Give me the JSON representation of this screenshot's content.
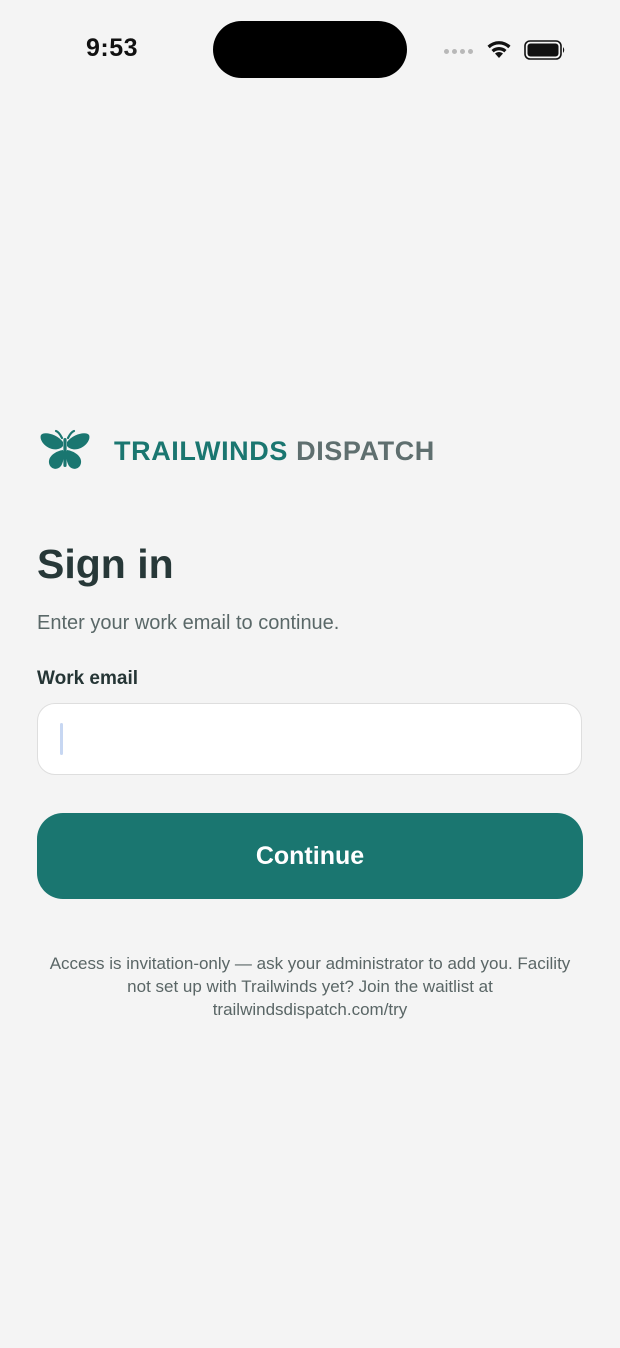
{
  "status_bar": {
    "time": "9:53"
  },
  "brand": {
    "logo_icon": "butterfly-icon",
    "name_primary": "TRAILWINDS",
    "name_secondary": "DISPATCH",
    "primary_color": "#1a7670"
  },
  "signin": {
    "title": "Sign in",
    "subtitle": "Enter your work email to continue.",
    "email_label": "Work email",
    "email_value": "",
    "email_placeholder": "",
    "continue_label": "Continue",
    "footnote": "Access is invitation-only — ask your administrator to add you. Facility not set up with Trailwinds yet? Join the waitlist at trailwindsdispatch.com/try"
  }
}
